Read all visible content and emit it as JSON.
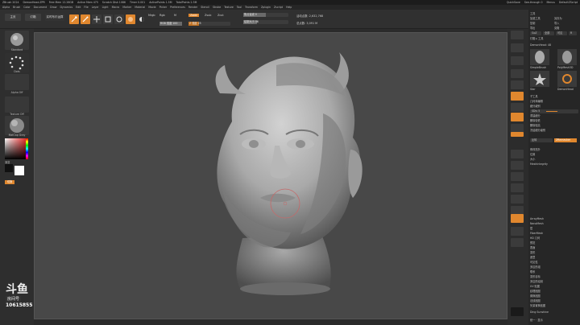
{
  "titlebar": {
    "items": [
      "ZBrush 2024",
      "DemonHead.ZPR",
      "Free Mem 12.26GB",
      "Active Mem 475",
      "Scratch Disk 1086",
      "Timer 0.001",
      "ActivePoints 1.5M",
      "TotalPoints 2.3M"
    ],
    "right": [
      "QuickSave",
      "See-through 0",
      "Menus",
      "DefaultZScript"
    ]
  },
  "menubar": {
    "items": [
      "Alpha",
      "Brush",
      "Color",
      "Document",
      "Draw",
      "Dynamics",
      "Edit",
      "File",
      "Layer",
      "Light",
      "Macro",
      "Marker",
      "Material",
      "Movie",
      "Picker",
      "Preferences",
      "Render",
      "Stencil",
      "Stroke",
      "Texture",
      "Tool",
      "Transform",
      "Zplugin",
      "Zscript",
      "Help"
    ]
  },
  "toolbar": {
    "home_label": "主页",
    "lightbox_label": "灯箱",
    "live_boolean_label": "实时布尔运算",
    "edit_label": "编辑",
    "draw_label": "绘制",
    "move_label": "移动",
    "scale_label": "缩放",
    "rotate_label": "旋转",
    "mrgb_label": "Mrgb",
    "rgb_label": "Rgb",
    "m_label": "M",
    "zadd_label": "Zadd",
    "zsub_label": "Zsub",
    "zcut_label": "Zcut",
    "focal_label": "焦点衰减 0",
    "draw_size_label": "绘制大小 46",
    "z_intensity_label": "Z 强度 25",
    "rgb_intensity_label": "RGB 强度 100",
    "active_points": "活动点数: 2,632,768",
    "total_points": "总点数: 3,091 M"
  },
  "leftshelf": {
    "brush_label": "Standard",
    "stroke_label": "Dots",
    "alpha_label": "Alpha Off",
    "texture_label": "Texture Off",
    "material_label": "MatCap Gray",
    "gradient_label": "渐变",
    "switch_label": "切换"
  },
  "watermark": {
    "logo_text": "斗鱼",
    "sub_text": "房间号",
    "room_number": "10615855"
  },
  "rightpanel": {
    "header": [
      "工具",
      "加载工具",
      "另存为",
      "复制",
      "导入",
      "导出",
      "克隆",
      "GoZ",
      "全部",
      "可见",
      "R",
      "灯箱 ▸ 工具"
    ],
    "tool_name": "DemonHead: 48",
    "subtools": [
      "SimpleBrush",
      "PolyMesh3D",
      "Star",
      "DemonHead"
    ],
    "sections": [
      "子工具",
      "几何体编辑",
      "细分级别",
      "SDiv 5",
      "重建细分",
      "删除较低",
      "删除较高",
      "冻结细分级别",
      "反转",
      "ZRemesher",
      "修改拓扑",
      "位置",
      "大小",
      "MeshIntegrity",
      "ArrayMesh",
      "NanoMesh",
      "层",
      "FiberMesh",
      "HD 几何",
      "预览",
      "表面",
      "变形",
      "遮罩",
      "可见性",
      "多边形组",
      "联系",
      "变形目标",
      "多边形绘制",
      "UV 贴图",
      "纹理贴图",
      "置换贴图",
      "法线贴图",
      "矢量置换贴图",
      "显示属性",
      "统一蒙皮",
      "初始化",
      "导入",
      "导出"
    ],
    "active_tab": "SDiv",
    "footer": [
      "Ding Sunshine",
      "统一 · 显示"
    ]
  },
  "colors": {
    "accent": "#e0872e",
    "canvas": "#484848",
    "panel": "#262626"
  }
}
